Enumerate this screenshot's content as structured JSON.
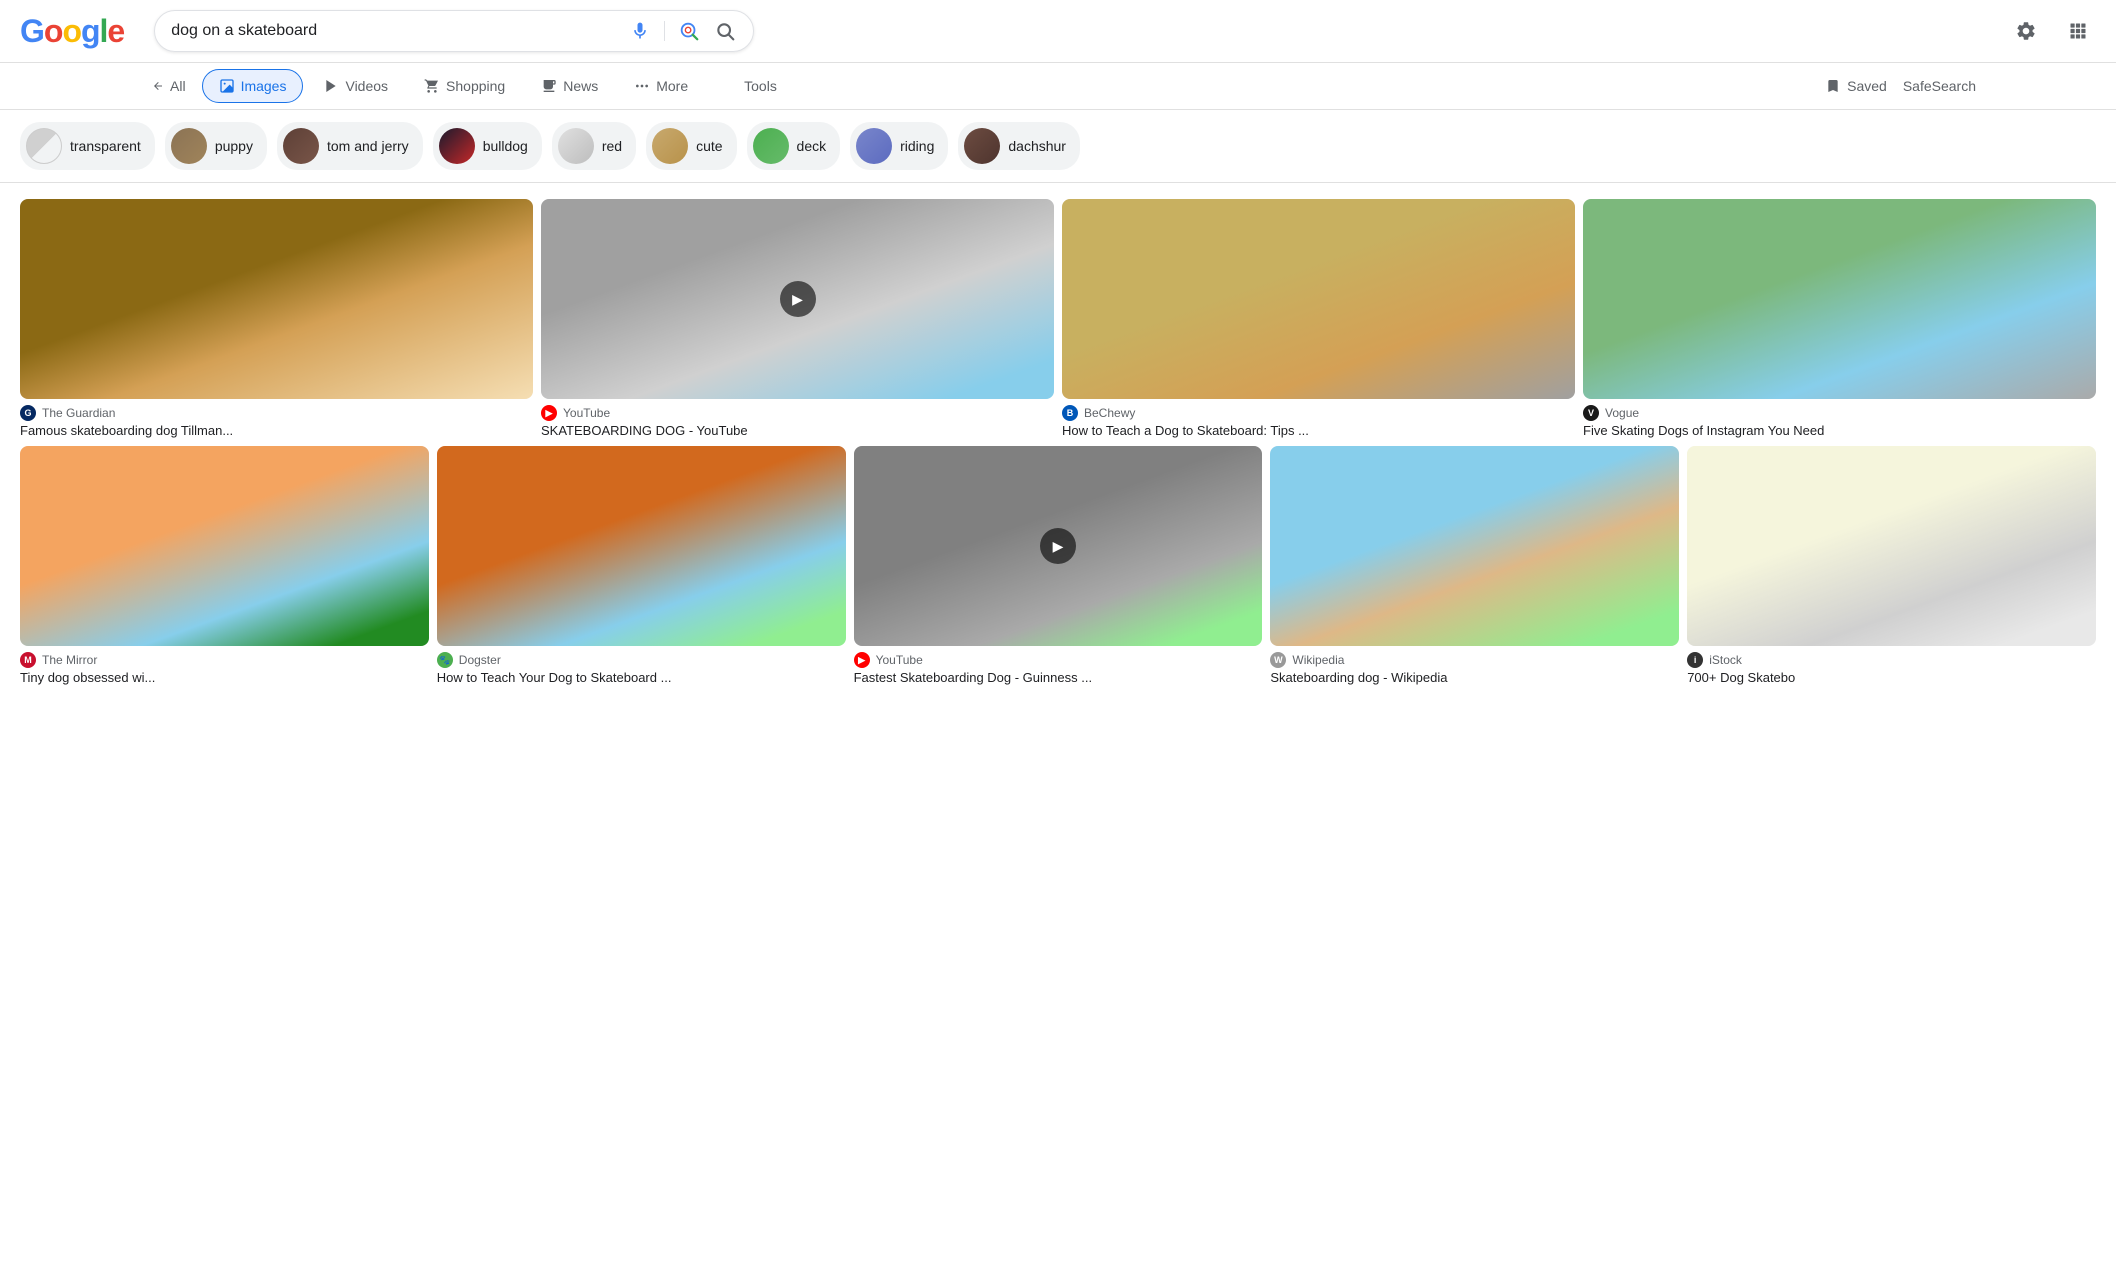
{
  "header": {
    "logo": "Google",
    "search_query": "dog on a skateboard",
    "settings_icon": "gear-icon",
    "apps_icon": "grid-icon"
  },
  "nav": {
    "back_label": "All",
    "tabs": [
      {
        "id": "images",
        "label": "Images",
        "active": true
      },
      {
        "id": "videos",
        "label": "Videos",
        "active": false
      },
      {
        "id": "shopping",
        "label": "Shopping",
        "active": false
      },
      {
        "id": "news",
        "label": "News",
        "active": false
      },
      {
        "id": "more",
        "label": "More",
        "active": false
      }
    ],
    "tools_label": "Tools",
    "saved_label": "Saved",
    "safesearch_label": "SafeSearch"
  },
  "filters": [
    {
      "id": "transparent",
      "label": "transparent",
      "thumb_class": "thumb-transparent"
    },
    {
      "id": "puppy",
      "label": "puppy",
      "thumb_class": "thumb-puppy"
    },
    {
      "id": "tom-jerry",
      "label": "tom and jerry",
      "thumb_class": "thumb-tom-jerry"
    },
    {
      "id": "bulldog",
      "label": "bulldog",
      "thumb_class": "thumb-bulldog"
    },
    {
      "id": "red",
      "label": "red",
      "thumb_class": "thumb-red"
    },
    {
      "id": "cute",
      "label": "cute",
      "thumb_class": "thumb-cute"
    },
    {
      "id": "deck",
      "label": "deck",
      "thumb_class": "thumb-deck"
    },
    {
      "id": "riding",
      "label": "riding",
      "thumb_class": "thumb-riding"
    },
    {
      "id": "dachshund",
      "label": "dachshur",
      "thumb_class": "thumb-dachshund"
    }
  ],
  "images_row1": [
    {
      "id": "img1",
      "source_icon_class": "source-guardian",
      "source_icon_label": "G",
      "source_name": "The Guardian",
      "title": "Famous skateboarding dog Tillman...",
      "img_class": "img-1",
      "is_video": false
    },
    {
      "id": "img2",
      "source_icon_class": "source-youtube",
      "source_icon_label": "▶",
      "source_name": "YouTube",
      "title": "SKATEBOARDING DOG - YouTube",
      "img_class": "img-2",
      "is_video": true
    },
    {
      "id": "img3",
      "source_icon_class": "source-bechewy",
      "source_icon_label": "B",
      "source_name": "BeChewy",
      "title": "How to Teach a Dog to Skateboard: Tips ...",
      "img_class": "img-3",
      "is_video": false
    },
    {
      "id": "img4",
      "source_icon_class": "source-vogue",
      "source_icon_label": "V",
      "source_name": "Vogue",
      "title": "Five Skating Dogs of Instagram You Need",
      "img_class": "img-4",
      "is_video": false
    }
  ],
  "images_row2": [
    {
      "id": "img5",
      "source_icon_class": "source-mirror",
      "source_icon_label": "M",
      "source_name": "The Mirror",
      "title": "Tiny dog obsessed wi...",
      "img_class": "img-5",
      "is_video": false
    },
    {
      "id": "img6",
      "source_icon_class": "source-dogster",
      "source_icon_label": "🐾",
      "source_name": "Dogster",
      "title": "How to Teach Your Dog to Skateboard ...",
      "img_class": "img-6",
      "is_video": false
    },
    {
      "id": "img7",
      "source_icon_class": "source-youtube",
      "source_icon_label": "▶",
      "source_name": "YouTube",
      "title": "Fastest Skateboarding Dog - Guinness ...",
      "img_class": "img-7",
      "is_video": true
    },
    {
      "id": "img8",
      "source_icon_class": "source-wikipedia",
      "source_icon_label": "W",
      "source_name": "Wikipedia",
      "title": "Skateboarding dog - Wikipedia",
      "img_class": "img-8",
      "is_video": false
    },
    {
      "id": "img9",
      "source_icon_class": "source-istock",
      "source_icon_label": "i",
      "source_name": "iStock",
      "title": "700+ Dog Skatebo",
      "img_class": "img-9",
      "is_video": false
    }
  ]
}
